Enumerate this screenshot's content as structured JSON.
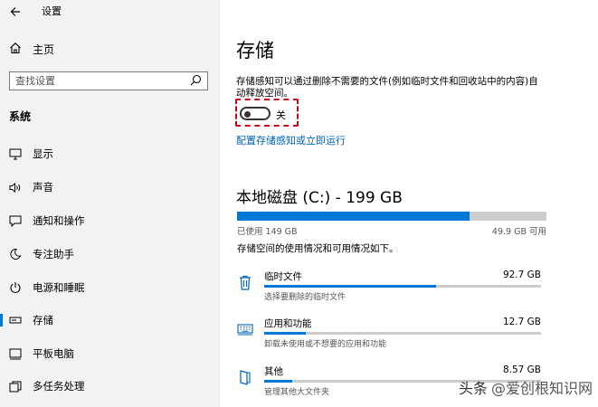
{
  "window": {
    "title": "设置"
  },
  "sidebar": {
    "home_label": "主页",
    "search_placeholder": "查找设置",
    "section_title": "系统",
    "items": [
      {
        "label": "显示",
        "icon": "monitor-icon"
      },
      {
        "label": "声音",
        "icon": "speaker-icon"
      },
      {
        "label": "通知和操作",
        "icon": "notification-icon"
      },
      {
        "label": "专注助手",
        "icon": "moon-icon"
      },
      {
        "label": "电源和睡眠",
        "icon": "power-icon"
      },
      {
        "label": "存储",
        "icon": "storage-icon",
        "active": true
      },
      {
        "label": "平板电脑",
        "icon": "tablet-icon"
      },
      {
        "label": "多任务处理",
        "icon": "multitask-icon"
      }
    ]
  },
  "main": {
    "title": "存储",
    "description": "存储感知可以通过删除不需要的文件(例如临时文件和回收站中的内容)自动释放空间。",
    "toggle_label": "关",
    "toggle_state": "off",
    "configure_link": "配置存储感知或立即运行",
    "drive": {
      "title": "本地磁盘 (C:) - 199 GB",
      "used": "已使用 149 GB",
      "free": "49.9 GB 可用",
      "used_fraction": 0.75
    },
    "usage_text": "存储空间的使用情况和可用情况如下。",
    "categories": [
      {
        "name": "临时文件",
        "size": "92.7 GB",
        "sub": "选择要删除的临时文件",
        "fraction": 0.62,
        "icon": "trash-icon"
      },
      {
        "name": "应用和功能",
        "size": "12.7 GB",
        "sub": "卸载未使用或不想要的应用和功能",
        "fraction": 0.15,
        "icon": "keyboard-icon"
      },
      {
        "name": "其他",
        "size": "8.57 GB",
        "sub": "管理其他大文件夹",
        "fraction": 0.1,
        "icon": "folder-icon"
      }
    ]
  },
  "watermark": {
    "text_a": "头条",
    "text_b": "@爱创根知识网"
  },
  "colors": {
    "accent": "#0078d7",
    "link": "#0063b1",
    "highlight": "#d0021b"
  }
}
